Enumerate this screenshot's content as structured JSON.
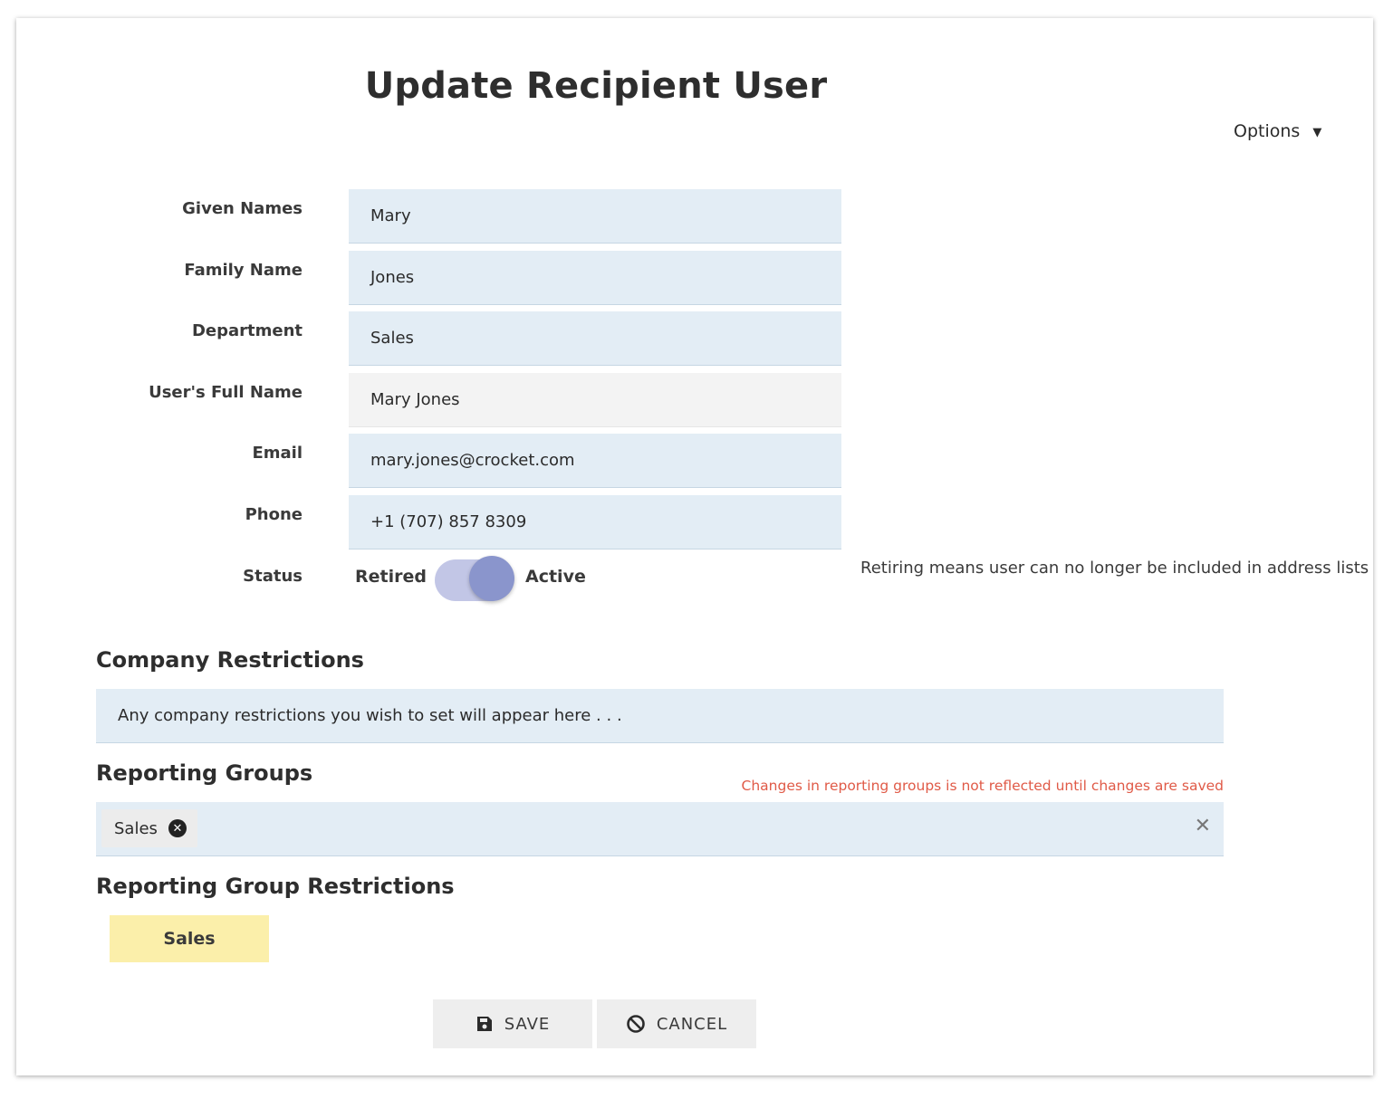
{
  "page": {
    "title": "Update Recipient User"
  },
  "options": {
    "label": "Options",
    "caret": "▼"
  },
  "fields": {
    "given_names": {
      "label": "Given Names",
      "value": "Mary"
    },
    "family_name": {
      "label": "Family Name",
      "value": "Jones"
    },
    "department": {
      "label": "Department",
      "value": "Sales"
    },
    "full_name": {
      "label": "User's Full Name",
      "value": "Mary Jones"
    },
    "email": {
      "label": "Email",
      "value": "mary.jones@crocket.com"
    },
    "phone": {
      "label": "Phone",
      "value": "+1 (707) 857 8309"
    }
  },
  "status": {
    "label": "Status",
    "off_label": "Retired",
    "on_label": "Active",
    "active": true,
    "hint": "Retiring means user can no longer be included in address lists"
  },
  "company_restrictions": {
    "title": "Company Restrictions",
    "placeholder": "Any company restrictions you wish to set will appear here . . ."
  },
  "reporting_groups": {
    "title": "Reporting Groups",
    "warning": "Changes in reporting groups is not reflected until changes are saved",
    "chips": [
      "Sales"
    ],
    "remove_chip_glyph": "✕",
    "clear_glyph": "✕"
  },
  "reporting_group_restrictions": {
    "title": "Reporting Group Restrictions",
    "tags": [
      "Sales"
    ],
    "tag_color": "#fbefaa"
  },
  "actions": {
    "save_label": "SAVE",
    "cancel_label": "CANCEL",
    "save_icon": "floppy-disk-icon",
    "cancel_icon": "ban-icon"
  },
  "colors": {
    "field_bg": "#e3edf5",
    "readonly_bg": "#f3f3f3",
    "toggle_track": "#c2c6e6",
    "toggle_knob": "#8a95cc",
    "warning": "#e05a47",
    "button_bg": "#eeeeee"
  }
}
